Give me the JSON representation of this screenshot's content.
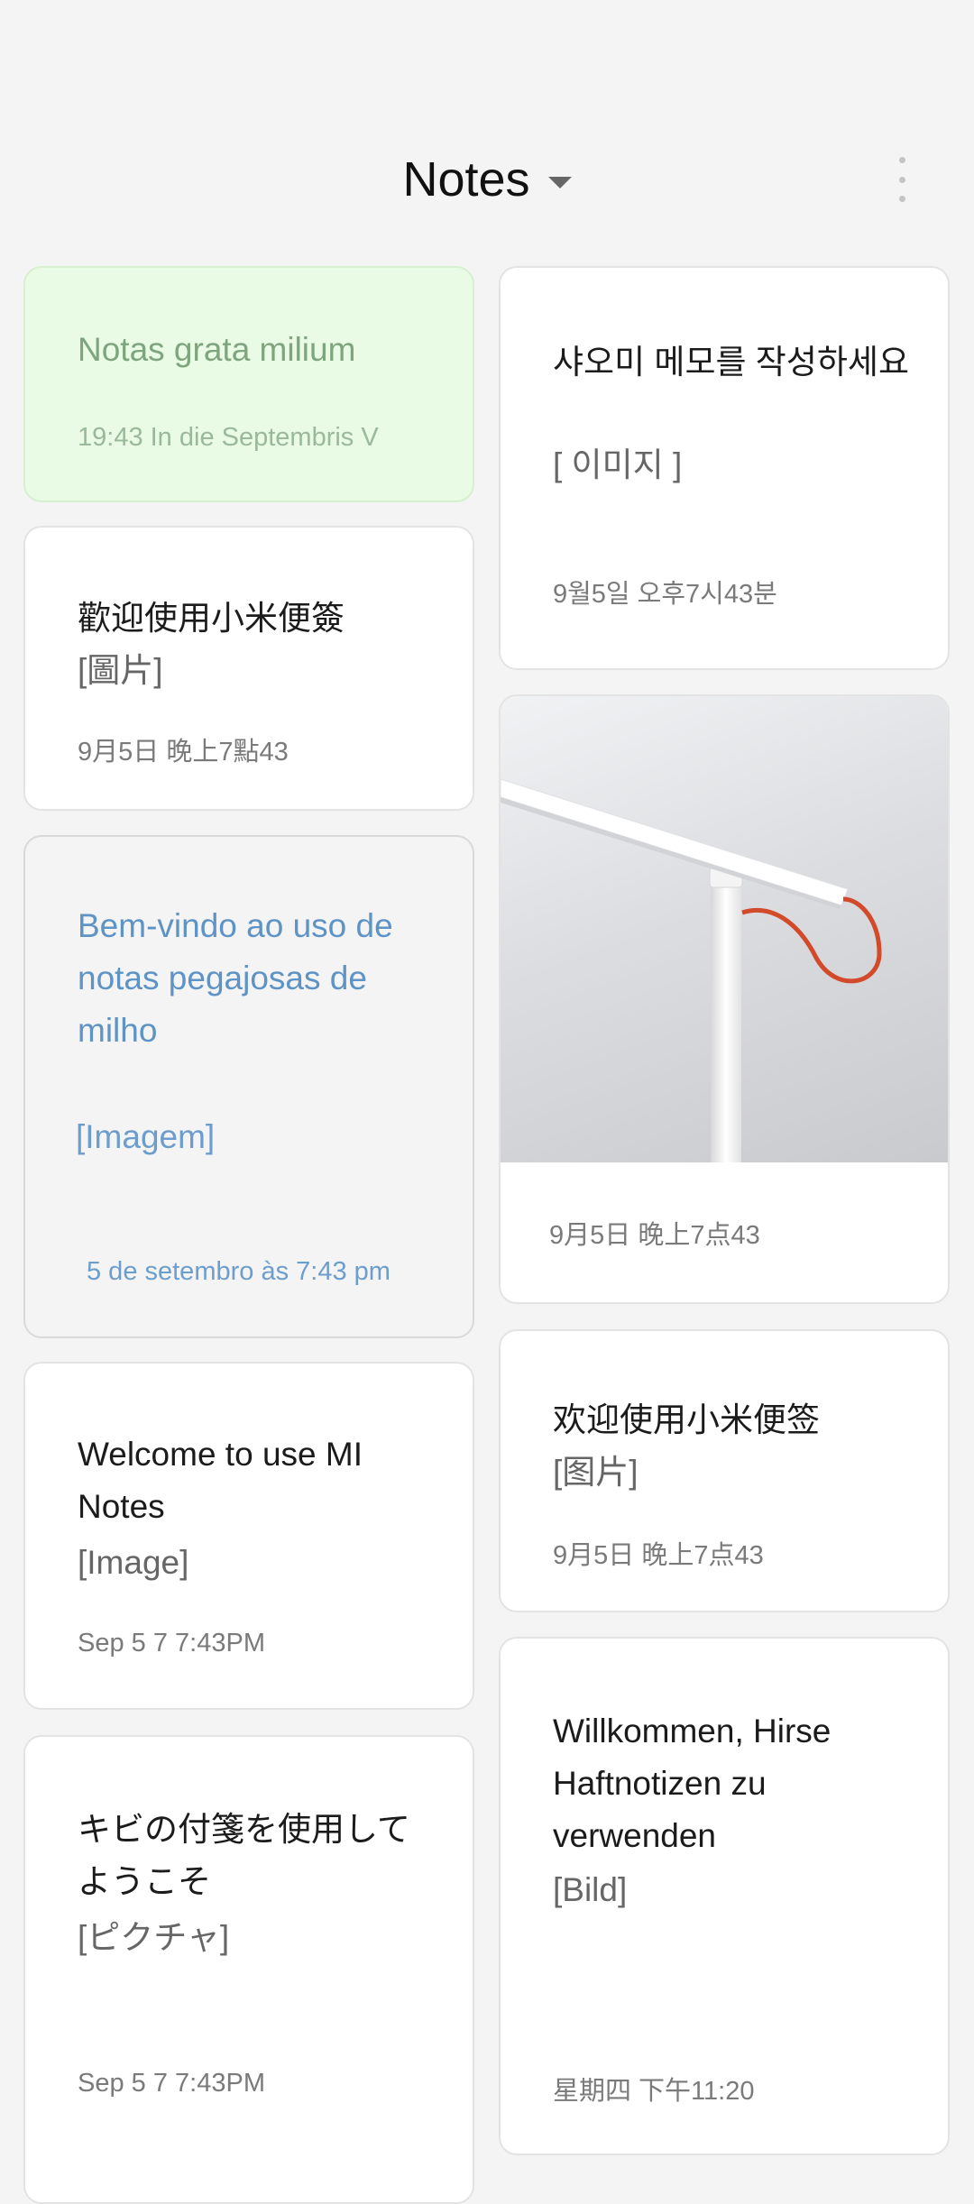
{
  "header": {
    "title": "Notes"
  },
  "notes_left": [
    {
      "title": "Notas grata milium",
      "attachment": "",
      "date": "19:43 In die Septembris V"
    },
    {
      "title": "歡迎使用小米便簽",
      "attachment": "[圖片]",
      "date": "9月5日 晚上7點43"
    },
    {
      "title": "Bem-vindo ao uso de notas pegajosas de milho",
      "attachment": "[Imagem]",
      "date": "5 de setembro às 7:43 pm"
    },
    {
      "title": "Welcome to use MI Notes",
      "attachment": "[Image]",
      "date": "Sep 5 7 7:43PM"
    },
    {
      "title": "キビの付箋を使用してようこそ",
      "attachment": "[ピクチャ]",
      "date": "Sep 5 7 7:43PM"
    }
  ],
  "notes_right": [
    {
      "title": "샤오미 메모를 작성하세요",
      "attachment": "[ 이미지 ]",
      "date": "9월5일  오후7시43분"
    },
    {
      "title": "",
      "attachment": "",
      "date": "9月5日 晚上7点43"
    },
    {
      "title": "欢迎使用小米便签",
      "attachment": "[图片]",
      "date": "9月5日 晚上7点43"
    },
    {
      "title": "Willkommen, Hirse Haftnotizen zu verwenden",
      "attachment": "[Bild]",
      "date": "星期四 下午11:20"
    }
  ],
  "colors": {
    "background": "#f4f4f4",
    "green_note_bg": "#e9fbe4",
    "green_note_text": "#7fa57f",
    "blue_note_text": "#5e93c5",
    "lamp_cable": "#d24a2a"
  }
}
